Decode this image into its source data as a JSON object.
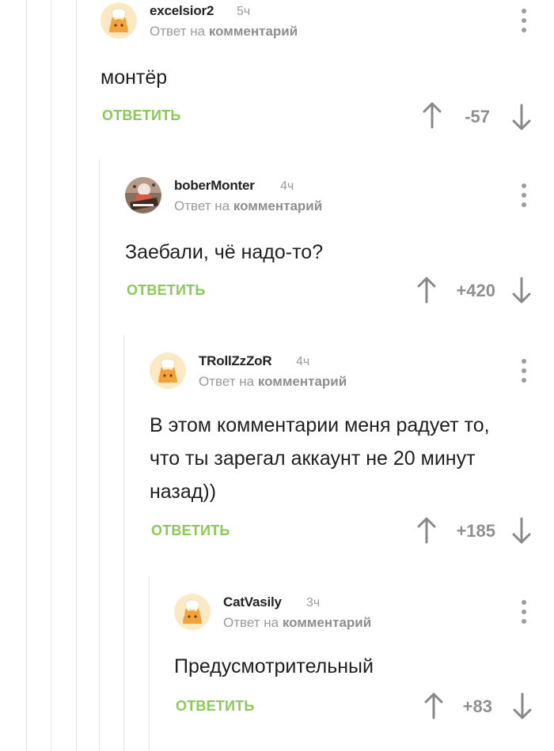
{
  "comments": [
    {
      "author": "excelsior2",
      "time": "5ч",
      "reply_prefix": "Ответ на",
      "reply_target": "комментарий",
      "text": "монтёр",
      "reply_label": "ОТВЕТИТЬ",
      "rating": "-57",
      "avatar": "default-chef-cat-avatar"
    },
    {
      "author": "boberMonter",
      "time": "4ч",
      "reply_prefix": "Ответ на",
      "reply_target": "комментарий",
      "text": "Заебали, чё надо-то?",
      "reply_label": "ОТВЕТИТЬ",
      "rating": "+420",
      "avatar": "custom-photo-avatar"
    },
    {
      "author": "TRollZzZoR",
      "time": "4ч",
      "reply_prefix": "Ответ на",
      "reply_target": "комментарий",
      "text": "В этом комментарии меня радует то,\nчто ты зарегал аккаунт не 20 минут\nназад))",
      "reply_label": "ОТВЕТИТЬ",
      "rating": "+185",
      "avatar": "default-chef-cat-avatar"
    },
    {
      "author": "CatVasily",
      "time": "3ч",
      "reply_prefix": "Ответ на",
      "reply_target": "комментарий",
      "text": "Предусмотрительный",
      "reply_label": "ОТВЕТИТЬ",
      "rating": "+83",
      "avatar": "default-chef-cat-avatar"
    }
  ],
  "colors": {
    "reply_green": "#8ac858",
    "muted_gray": "#9a9a9a",
    "thread_line": "#e6e6e6",
    "avatar_bg": "#fbe9c4",
    "avatar_cat": "#f3a33b"
  },
  "icons": {
    "menu": "more-vertical-icon",
    "upvote": "arrow-up-icon",
    "downvote": "arrow-down-icon"
  }
}
